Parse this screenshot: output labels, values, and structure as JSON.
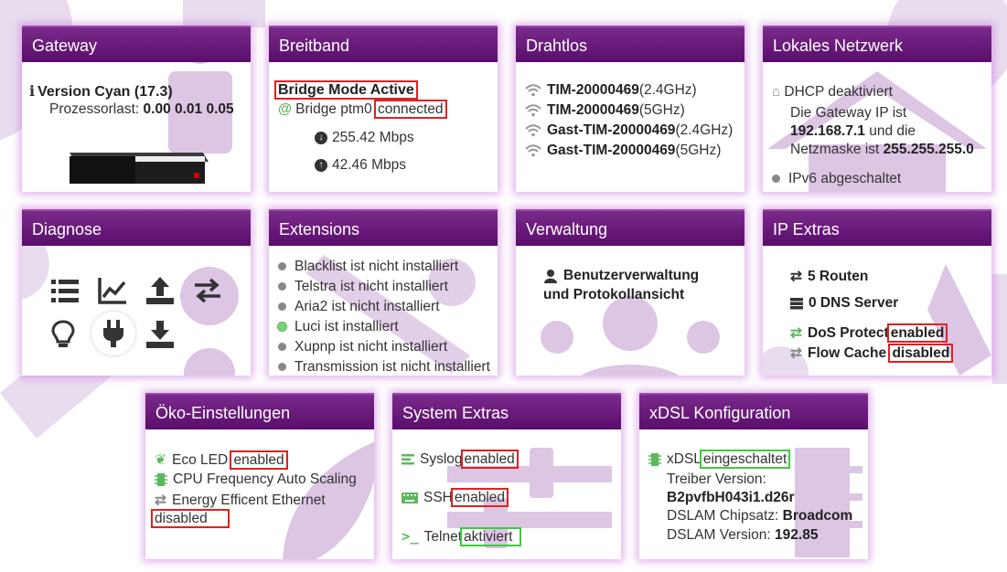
{
  "cards": {
    "gateway": {
      "title": "Gateway",
      "version": "Version Cyan (17.3)",
      "load_label": "Prozessorlast:",
      "load_value": "0.00 0.01 0.05"
    },
    "broadband": {
      "title": "Breitband",
      "bridge_mode": "Bridge Mode Active",
      "bridge_label": "Bridge ptm0",
      "bridge_status": "connected",
      "download": "255.42 Mbps",
      "upload": "42.46 Mbps"
    },
    "wireless": {
      "title": "Drahtlos",
      "networks": [
        {
          "ssid": "TIM-20000469",
          "band": "(2.4GHz)"
        },
        {
          "ssid": "TIM-20000469",
          "band": "(5GHz)"
        },
        {
          "ssid": "Gast-TIM-20000469",
          "band": "(2.4GHz)"
        },
        {
          "ssid": "Gast-TIM-20000469",
          "band": "(5GHz)"
        }
      ]
    },
    "lan": {
      "title": "Lokales Netzwerk",
      "dhcp": "DHCP deaktiviert",
      "gw_text_1": "Die Gateway IP ist",
      "gw_ip": "192.168.7.1",
      "gw_text_2": "und die",
      "mask_text": "Netzmaske ist",
      "mask": "255.255.255.0",
      "ipv6": "IPv6 abgeschaltet"
    },
    "diagnose": {
      "title": "Diagnose"
    },
    "extensions": {
      "title": "Extensions",
      "items": [
        {
          "label": "Blacklist ist nicht installiert",
          "installed": false
        },
        {
          "label": "Telstra ist nicht installiert",
          "installed": false
        },
        {
          "label": "Aria2 ist nicht installiert",
          "installed": false
        },
        {
          "label": "Luci ist installiert",
          "installed": true
        },
        {
          "label": "Xupnp ist nicht installiert",
          "installed": false
        },
        {
          "label": "Transmission ist nicht installiert",
          "installed": false
        }
      ]
    },
    "admin": {
      "title": "Verwaltung",
      "line1": "Benutzerverwaltung",
      "line2": "und Protokollansicht"
    },
    "ip_extras": {
      "title": "IP Extras",
      "routes": "5 Routen",
      "dns": "0 DNS Server",
      "dos_label": "DoS Protect",
      "dos_value": "enabled",
      "flow_label": "Flow Cache",
      "flow_value": "disabled"
    },
    "eco": {
      "title": "Öko-Einstellungen",
      "eco_led_label": "Eco LED",
      "eco_led_value": "enabled",
      "cpu_scaling": "CPU Frequency Auto Scaling",
      "eee_label": "Energy Efficent Ethernet",
      "eee_value": "disabled"
    },
    "system_extras": {
      "title": "System Extras",
      "syslog_label": "Syslog",
      "syslog_value": "enabled",
      "ssh_label": "SSH",
      "ssh_value": "enabled",
      "telnet_label": "Telnet",
      "telnet_value": "aktiviert"
    },
    "xdsl": {
      "title": "xDSL Konfiguration",
      "xdsl_label": "xDSL",
      "xdsl_value": "eingeschaltet",
      "driver_label": "Treiber Version:",
      "driver_value": "B2pvfbH043i1.d26r",
      "chipset_label": "DSLAM Chipsatz:",
      "chipset_value": "Broadcom",
      "dslam_version_label": "DSLAM Version:",
      "dslam_version_value": "192.85"
    }
  },
  "colors": {
    "header": "#5a0d6c",
    "watermark": "#d9c2e0",
    "highlight_red": "#e02020",
    "highlight_green": "#3ccc3c",
    "icon_green": "#5cb85c"
  }
}
